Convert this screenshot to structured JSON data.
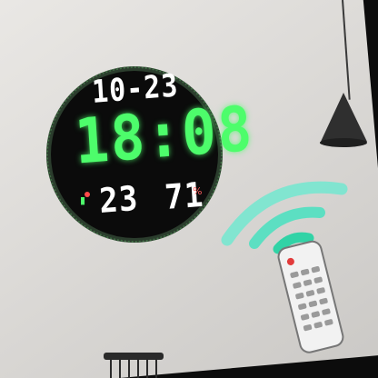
{
  "photo": {
    "clock_display": {
      "date": "10-23",
      "time": "18:08",
      "temperature": "23",
      "humidity": "71",
      "digit_color": "#4dfd6b",
      "date_color": "#ffffff"
    },
    "colors": {
      "wall": "#e4e2df",
      "clock_body": "#0b0b0b",
      "signal_waves": "#5ee7c8",
      "remote": "#eeeeee",
      "pendant_lamp": "#333333"
    },
    "icons": [
      "pendant-lamp-icon",
      "remote-control-icon",
      "signal-wave-icon",
      "chair-icon"
    ]
  }
}
